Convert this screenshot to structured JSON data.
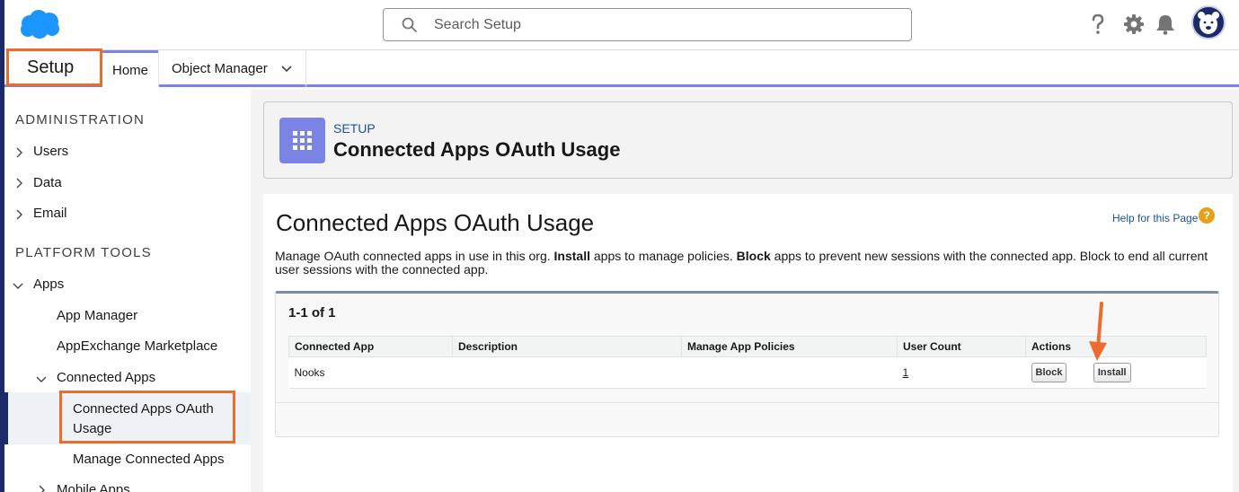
{
  "header": {
    "search_placeholder": "Search Setup",
    "icons": [
      "salesforce-cloud-logo",
      "help-icon",
      "gear-icon",
      "bell-icon",
      "avatar"
    ]
  },
  "nav": {
    "app_title": "Setup",
    "tabs": [
      {
        "label": "Home",
        "active": true
      },
      {
        "label": "Object Manager"
      }
    ]
  },
  "sidebar": {
    "sections": [
      {
        "title": "ADMINISTRATION",
        "items": [
          "Users",
          "Data",
          "Email"
        ]
      },
      {
        "title": "PLATFORM TOOLS"
      }
    ],
    "apps_label": "Apps",
    "app_manager": "App Manager",
    "appexchange": "AppExchange Marketplace",
    "connected_apps": "Connected Apps",
    "oauth_usage_line1": "Connected Apps OAuth",
    "oauth_usage_line2": "Usage",
    "manage_connected_apps": "Manage Connected Apps",
    "mobile_apps": "Mobile Apps"
  },
  "page_header": {
    "eyebrow": "SETUP",
    "title": "Connected Apps OAuth Usage"
  },
  "content": {
    "title": "Connected Apps OAuth Usage",
    "help_link": "Help for this Page",
    "desc_part1": "Manage OAuth connected apps in use in this org. ",
    "desc_bold1": "Install",
    "desc_part2": " apps to manage policies. ",
    "desc_bold2": "Block",
    "desc_part3": " apps to prevent new sessions with the connected app. Block to end all current user sessions with the connected app.",
    "count": "1-1 of 1",
    "table": {
      "headers": [
        "Connected App",
        "Description",
        "Manage App Policies",
        "User Count",
        "Actions"
      ],
      "rows": [
        {
          "app": "Nooks",
          "description": "",
          "policies": "",
          "user_count": "1",
          "block_label": "Block",
          "install_label": "Install"
        }
      ]
    }
  },
  "colors": {
    "highlight": "#ec6b2d",
    "accent": "#7b83e4",
    "link": "#1b5297",
    "brand_cloud": "#1b96ff"
  }
}
